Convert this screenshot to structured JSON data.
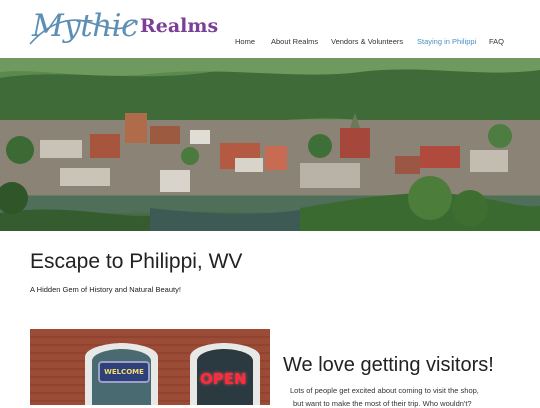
{
  "brand": {
    "script_word": "Mythic",
    "bold_word": "Realms",
    "script_color": "#5e8fb3",
    "bold_color": "#7b3f96"
  },
  "nav": {
    "items": [
      {
        "label": "Home",
        "active": false
      },
      {
        "label": "About Realms",
        "active": false
      },
      {
        "label": "Vendors & Volunteers",
        "active": false
      },
      {
        "label": "Staying in Philippi",
        "active": true
      },
      {
        "label": "FAQ",
        "active": false
      }
    ],
    "active_color": "#4a8fc4"
  },
  "hero": {
    "icon": "town-landscape-photo"
  },
  "main": {
    "title": "Escape to Philippi, WV",
    "subtitle": "A Hidden Gem of History and Natural Beauty!"
  },
  "shop_photo": {
    "welcome_sign": "WELCOME",
    "open_sign": "OPEN"
  },
  "visitors": {
    "heading": "We love getting visitors!",
    "line1": "Lots of people get excited about coming to visit the shop,",
    "line2": "but want to make the most of their trip. Who wouldn't?"
  }
}
